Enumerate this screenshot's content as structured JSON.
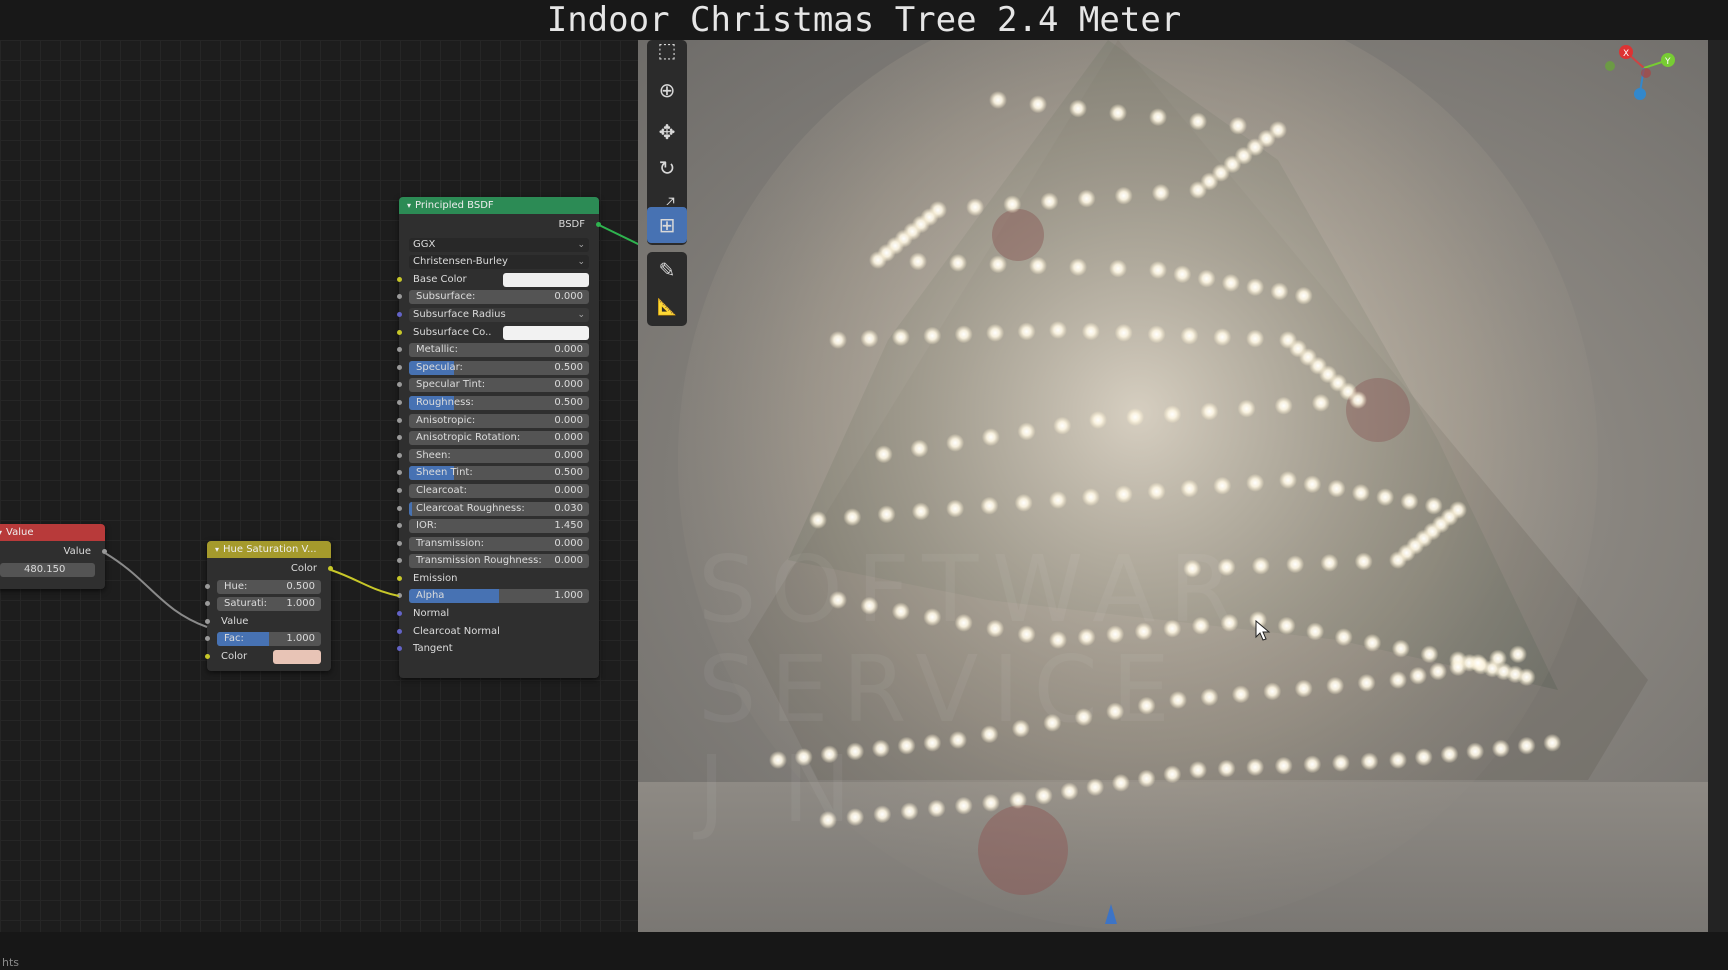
{
  "window_title": "Indoor Christmas Tree 2.4 Meter",
  "status_text": "hts",
  "nodes": {
    "value": {
      "title": "Value",
      "output_label": "Value",
      "value": "480.150",
      "color": "#b83a3a"
    },
    "hue_sat": {
      "title": "Hue Saturation V...",
      "output_label": "Color",
      "color": "#a59a2c",
      "hue_label": "Hue:",
      "hue_value": "0.500",
      "sat_label": "Saturati:",
      "sat_value": "1.000",
      "value_label": "Value",
      "fac_label": "Fac:",
      "fac_value": "1.000",
      "fac_fraction": 1.0,
      "color_label": "Color",
      "color_swatch": "#e8c4b6"
    },
    "bsdf": {
      "title": "Principled BSDF",
      "output_label": "BSDF",
      "color": "#2c8b55",
      "distribution": "GGX",
      "subsurface_method": "Christensen-Burley",
      "base_color_label": "Base Color",
      "base_color_swatch": "#f0f0f0",
      "subsurface_label": "Subsurface:",
      "subsurface_value": "0.000",
      "subsurface_radius_label": "Subsurface Radius",
      "subsurface_color_label": "Subsurface Co..",
      "subsurface_color_swatch": "#f2f2f2",
      "metallic_label": "Metallic:",
      "metallic_value": "0.000",
      "specular_label": "Specular:",
      "specular_value": "0.500",
      "specular_fraction": 0.5,
      "specular_tint_label": "Specular Tint:",
      "specular_tint_value": "0.000",
      "roughness_label": "Roughness:",
      "roughness_value": "0.500",
      "roughness_fraction": 0.5,
      "anisotropic_label": "Anisotropic:",
      "anisotropic_value": "0.000",
      "anisotropic_rotation_label": "Anisotropic Rotation:",
      "anisotropic_rotation_value": "0.000",
      "sheen_label": "Sheen:",
      "sheen_value": "0.000",
      "sheen_tint_label": "Sheen Tint:",
      "sheen_tint_value": "0.500",
      "sheen_tint_fraction": 0.5,
      "clearcoat_label": "Clearcoat:",
      "clearcoat_value": "0.000",
      "clearcoat_roughness_label": "Clearcoat Roughness:",
      "clearcoat_roughness_value": "0.030",
      "clearcoat_roughness_fraction": 0.03,
      "ior_label": "IOR:",
      "ior_value": "1.450",
      "transmission_label": "Transmission:",
      "transmission_value": "0.000",
      "transmission_roughness_label": "Transmission Roughness:",
      "transmission_roughness_value": "0.000",
      "emission_label": "Emission",
      "alpha_label": "Alpha",
      "alpha_value": "1.000",
      "alpha_fraction": 1.0,
      "normal_label": "Normal",
      "clearcoat_normal_label": "Clearcoat Normal",
      "tangent_label": "Tangent"
    }
  },
  "toolbar": {
    "tools": [
      {
        "icon": "select-box-icon",
        "glyph": "⬚"
      },
      {
        "icon": "cursor-icon",
        "glyph": "⊕"
      },
      {
        "icon": "move-icon",
        "glyph": "✥"
      },
      {
        "icon": "rotate-icon",
        "glyph": "↻"
      },
      {
        "icon": "scale-icon",
        "glyph": "⤢"
      },
      {
        "icon": "transform-icon",
        "glyph": "⊞"
      },
      {
        "icon": "annotate-icon",
        "glyph": "✎"
      },
      {
        "icon": "measure-icon",
        "glyph": "📐"
      }
    ]
  },
  "gizmo": {
    "x_label": "X",
    "y_label": "Y",
    "z_label": "Z"
  },
  "watermark": {
    "lines": [
      "SOFTWAR",
      "SERVICE",
      "J   N"
    ]
  }
}
